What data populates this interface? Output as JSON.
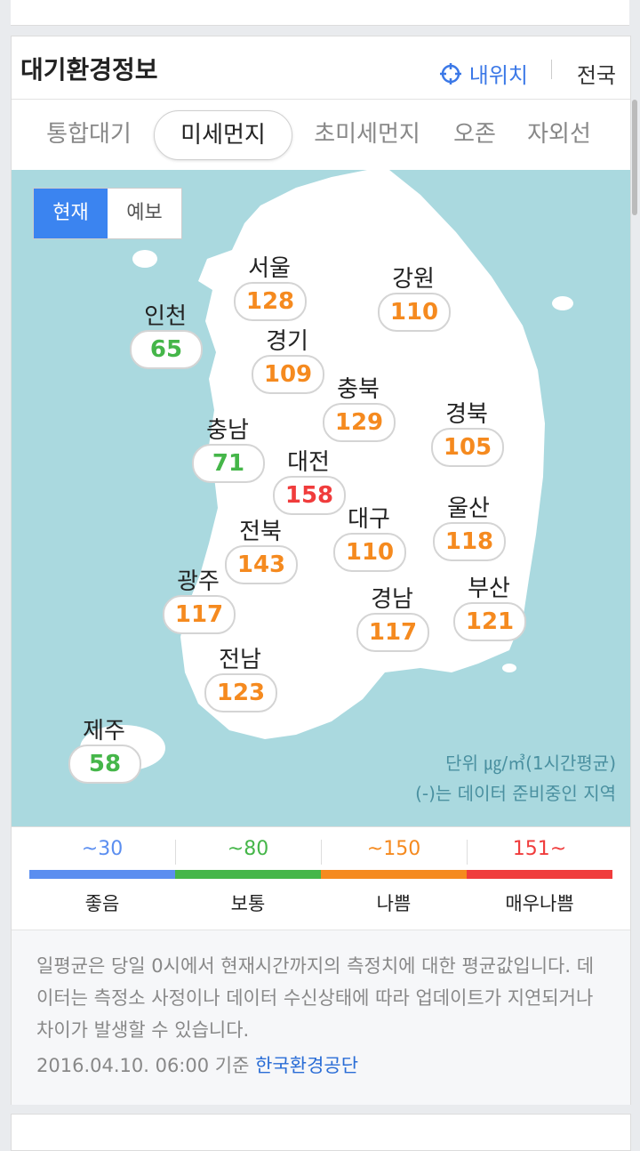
{
  "header": {
    "title": "대기환경정보",
    "my_location": "내위치",
    "region": "전국"
  },
  "tabs": [
    {
      "label": "통합대기"
    },
    {
      "label": "미세먼지",
      "active": true
    },
    {
      "label": "초미세먼지"
    },
    {
      "label": "오존"
    },
    {
      "label": "자외선"
    }
  ],
  "toggle": {
    "current": "현재",
    "forecast": "예보"
  },
  "regions": [
    {
      "name": "서울",
      "value": "128",
      "level": "나쁨"
    },
    {
      "name": "강원",
      "value": "110",
      "level": "나쁨"
    },
    {
      "name": "인천",
      "value": "65",
      "level": "보통"
    },
    {
      "name": "경기",
      "value": "109",
      "level": "나쁨"
    },
    {
      "name": "충북",
      "value": "129",
      "level": "나쁨"
    },
    {
      "name": "경북",
      "value": "105",
      "level": "나쁨"
    },
    {
      "name": "충남",
      "value": "71",
      "level": "보통"
    },
    {
      "name": "대전",
      "value": "158",
      "level": "매우나쁨"
    },
    {
      "name": "울산",
      "value": "118",
      "level": "나쁨"
    },
    {
      "name": "전북",
      "value": "143",
      "level": "나쁨"
    },
    {
      "name": "대구",
      "value": "110",
      "level": "나쁨"
    },
    {
      "name": "광주",
      "value": "117",
      "level": "나쁨"
    },
    {
      "name": "부산",
      "value": "121",
      "level": "나쁨"
    },
    {
      "name": "경남",
      "value": "117",
      "level": "나쁨"
    },
    {
      "name": "전남",
      "value": "123",
      "level": "나쁨"
    },
    {
      "name": "제주",
      "value": "58",
      "level": "보통"
    }
  ],
  "map_note": {
    "unit": "단위 ㎍/㎥(1시간평균)",
    "note": "(-)는 데이터 준비중인 지역"
  },
  "legend": [
    {
      "range": "~30",
      "label": "좋음",
      "color": "#5b8ef0"
    },
    {
      "range": "~80",
      "label": "보통",
      "color": "#45b649"
    },
    {
      "range": "~150",
      "label": "나쁨",
      "color": "#f58a1f"
    },
    {
      "range": "151~",
      "label": "매우나쁨",
      "color": "#f03c3c"
    }
  ],
  "notes": {
    "text": "일평균은 당일 0시에서 현재시간까지의 측정치에 대한 평균값입니다. 데이터는 측정소 사정이나 데이터 수신상태에 따라 업데이트가 지연되거나 차이가 발생할 수 있습니다.",
    "date": "2016.04.10. 06:00 기준",
    "source": "한국환경공단"
  },
  "colors": {
    "accent": "#3b84f0",
    "good": "#5b8ef0",
    "normal": "#45b649",
    "bad": "#f58a1f",
    "very_bad": "#f03c3c",
    "sea": "#aad9df"
  }
}
